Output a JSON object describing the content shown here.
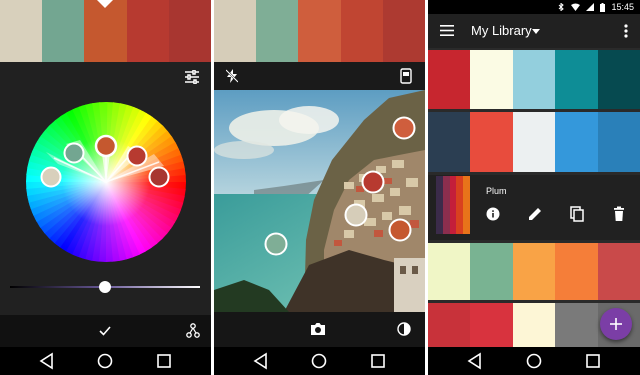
{
  "colors": {
    "accent_fab": "#7b3ea6",
    "navbar": "#000000",
    "panel": "#212121"
  },
  "capture_theme": {
    "swatches": [
      "#d8d0bc",
      "#73a691",
      "#c5582f",
      "#b73a30",
      "#a83630"
    ]
  },
  "camera_capture": {
    "swatches": [
      "#d6cdb9",
      "#7fae96",
      "#cf5e3d",
      "#c04532",
      "#ad3a31"
    ],
    "icons": [
      "flash-off-icon",
      "switch-camera-icon",
      "camera-icon",
      "contrast-icon"
    ]
  },
  "library": {
    "status_time": "15:45",
    "title": "My Library",
    "themes": [
      {
        "swatches": [
          "#c7262f",
          "#fbfbe4",
          "#93cfdd",
          "#0e8d96",
          "#064a50"
        ]
      },
      {
        "swatches": [
          "#2b3e52",
          "#e84c3d",
          "#ecf0f1",
          "#3498db",
          "#2a80b9"
        ]
      },
      {
        "name": "Plum",
        "swatches": [
          "#3b2b4a",
          "#8b2e4e",
          "#c41e3a",
          "#d9401f",
          "#e8731a"
        ]
      },
      {
        "swatches": [
          "#f0f6c6",
          "#79b392",
          "#f9a346",
          "#f57e39",
          "#c94a4a"
        ]
      },
      {
        "swatches": [
          "#c8323a",
          "#d8333e",
          "#fdf6d6",
          "#7a7a7a",
          "#6a6a6a"
        ]
      }
    ]
  }
}
